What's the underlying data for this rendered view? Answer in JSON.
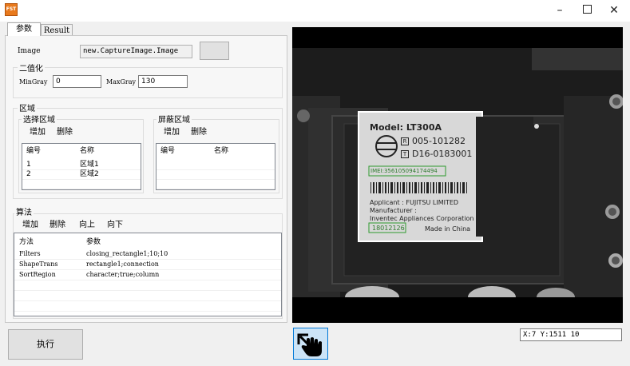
{
  "window": {
    "app_icon_text": "FST",
    "minimize": "–",
    "close": "✕"
  },
  "tabs": [
    {
      "label": "参数"
    },
    {
      "label": "Result"
    }
  ],
  "image_row": {
    "label": "Image",
    "value": "new.CaptureImage.Image"
  },
  "binarize": {
    "title": "二值化",
    "min_label": "MinGray",
    "min_value": "0",
    "max_label": "MaxGray",
    "max_value": "130"
  },
  "region": {
    "title": "区域",
    "select": {
      "title": "选择区域",
      "add": "增加",
      "delete": "删除",
      "headers": [
        "编号",
        "名称"
      ],
      "rows": [
        [
          "1",
          "区域1"
        ],
        [
          "2",
          "区域2"
        ]
      ]
    },
    "mask": {
      "title": "屏蔽区域",
      "add": "增加",
      "delete": "删除",
      "headers": [
        "编号",
        "名称"
      ]
    }
  },
  "algorithm": {
    "title": "算法",
    "add": "增加",
    "delete": "删除",
    "up": "向上",
    "down": "向下",
    "headers": [
      "方法",
      "参数"
    ],
    "rows": [
      [
        "Filters",
        "closing_rectangle1;10;10"
      ],
      [
        "ShapeTrans",
        "rectangle1;connection"
      ],
      [
        "SortRegion",
        "character;true;column"
      ]
    ]
  },
  "execute_label": "执行",
  "coords": "X:7 Y:1511 10",
  "label_image": {
    "model": "Model: LT300A",
    "r_mark": "R",
    "r_code": "005-101282",
    "t_mark": "T",
    "t_code": "D16-0183001",
    "imei": "IMEI:356105094174494",
    "applicant": "Applicant : FUJITSU LIMITED",
    "manufacturer_label": "Manufacturer :",
    "manufacturer": "Inventec Appliances Corporation",
    "date_code": "18012126",
    "made_in": "Made in China"
  }
}
